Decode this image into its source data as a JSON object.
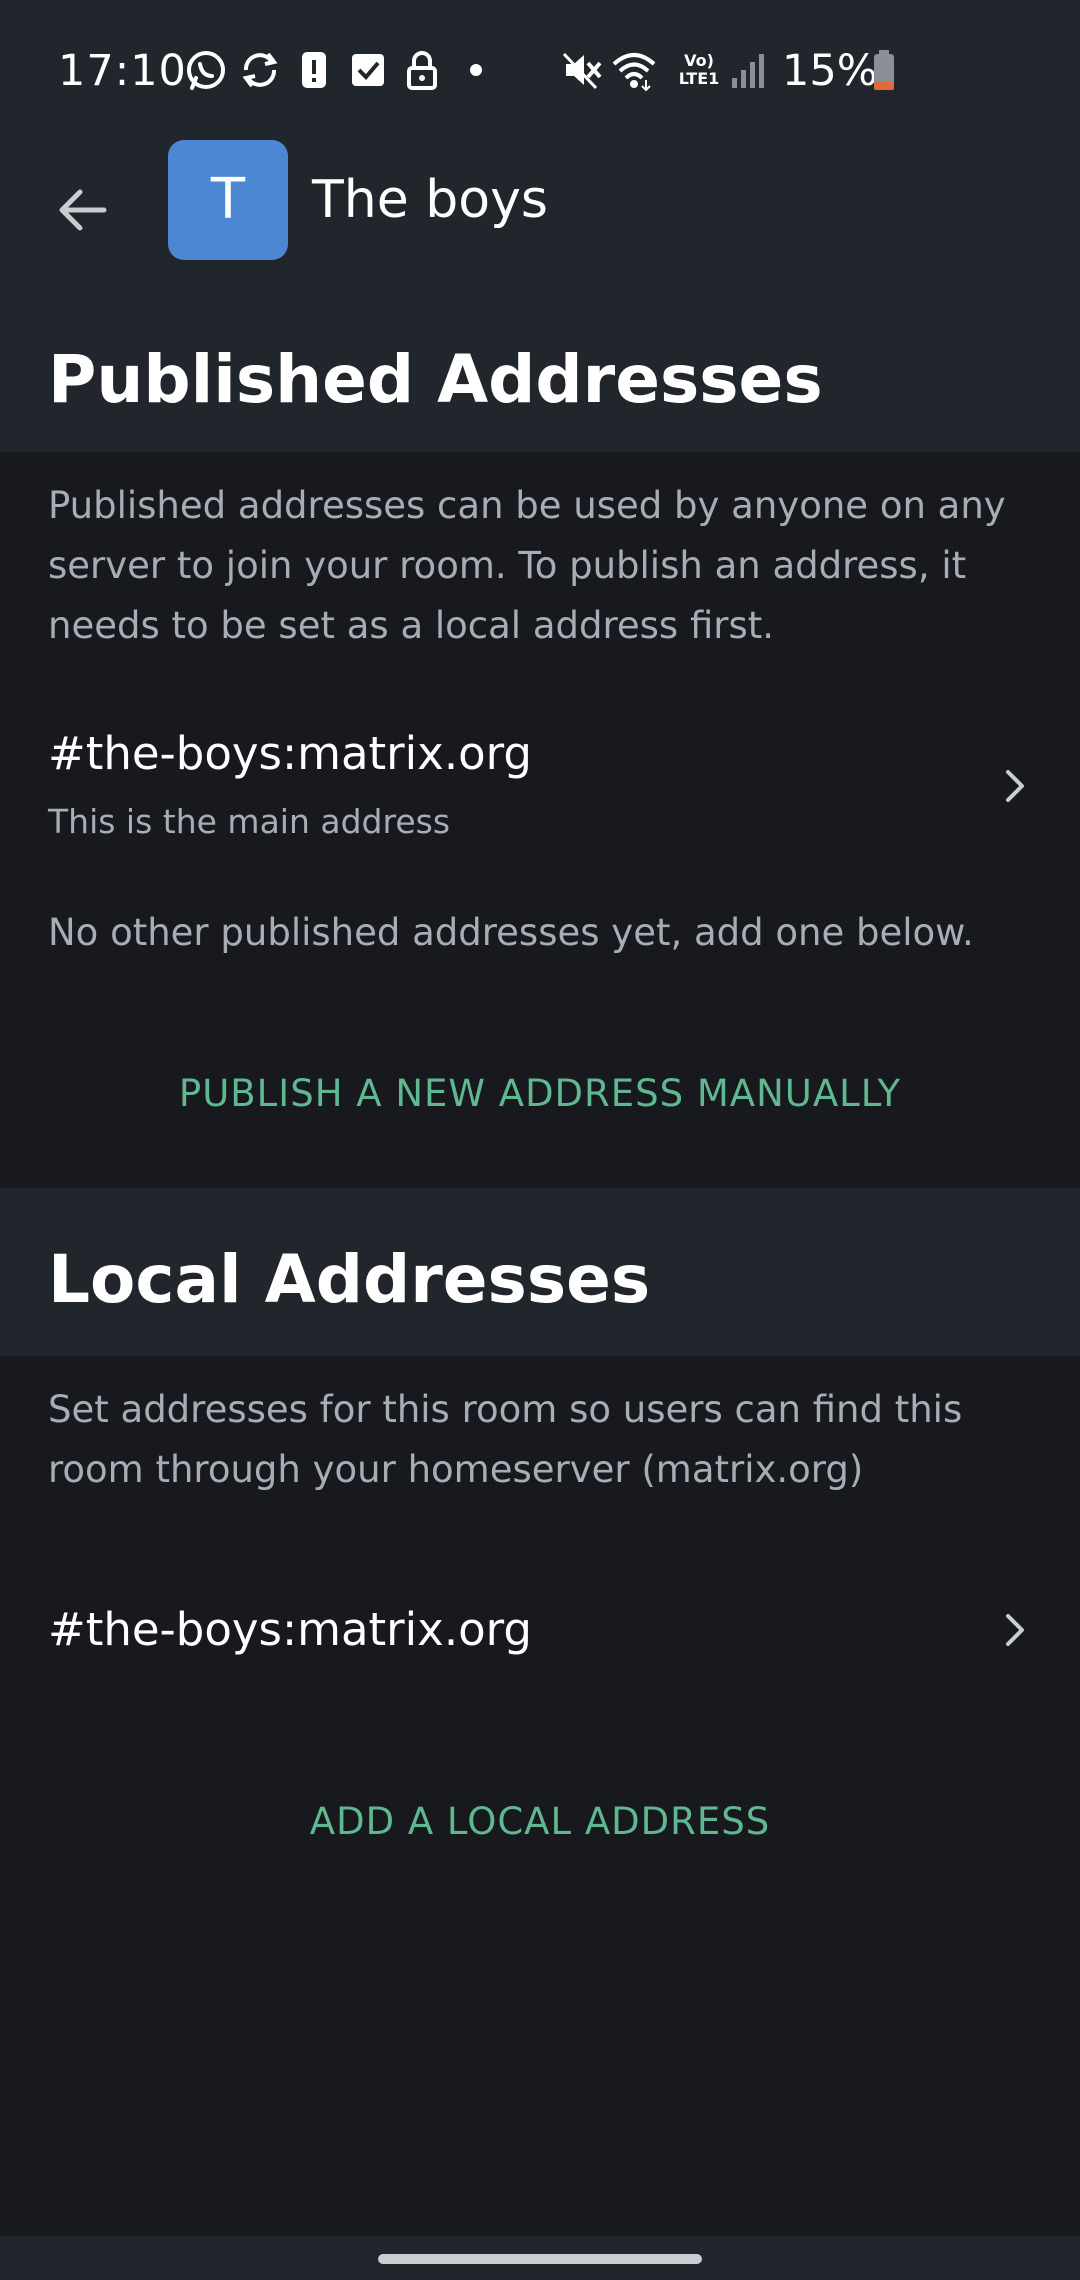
{
  "status_bar": {
    "time": "17:10",
    "battery": "15%",
    "network_label": "Vo) LTE1",
    "icons": [
      "whatsapp-icon",
      "sync-icon",
      "alert-icon",
      "check-icon",
      "lock-icon",
      "dot-icon",
      "mute-icon",
      "wifi-icon",
      "volte-icon",
      "signal-icon",
      "battery-icon"
    ],
    "battery_color": "#e06a3b"
  },
  "app_bar": {
    "avatar_letter": "T",
    "avatar_color": "#4b87d3",
    "room_name": "The boys"
  },
  "published": {
    "title": "Published Addresses",
    "description": "Published addresses can be used by anyone on any server to join your room. To publish an address, it needs to be set as a local address first.",
    "addresses": [
      {
        "address": "#the-boys:matrix.org",
        "subtitle": "This is the main address"
      }
    ],
    "empty_note": "No other published addresses yet, add one below.",
    "action": "PUBLISH A NEW ADDRESS MANUALLY"
  },
  "local": {
    "title": "Local Addresses",
    "description": "Set addresses for this room so users can find this room through your homeserver (matrix.org)",
    "addresses": [
      {
        "address": "#the-boys:matrix.org"
      }
    ],
    "action": "ADD A LOCAL ADDRESS"
  },
  "colors": {
    "accent": "#5fb88f",
    "background": "#17191e",
    "header_background": "#21252c"
  }
}
